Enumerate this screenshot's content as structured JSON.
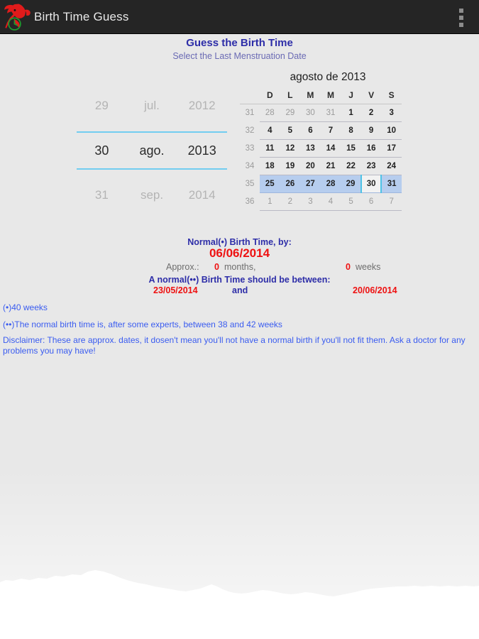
{
  "appbar": {
    "title": "Birth Time Guess",
    "logo_icon": "stork-clock-icon",
    "overflow_icon": "overflow-menu-icon"
  },
  "headings": {
    "title": "Guess the Birth Time",
    "subtitle": "Select the Last Menstruation Date"
  },
  "date_picker": {
    "day": {
      "prev": "29",
      "current": "30",
      "next": "31"
    },
    "month": {
      "prev": "jul.",
      "current": "ago.",
      "next": "sep."
    },
    "year": {
      "prev": "2012",
      "current": "2013",
      "next": "2014"
    }
  },
  "calendar": {
    "month_label": "agosto de 2013",
    "week_col_header": "",
    "weekday_headers": [
      "D",
      "L",
      "M",
      "M",
      "J",
      "V",
      "S"
    ],
    "weeks": [
      {
        "number": "31",
        "days": [
          {
            "label": "28",
            "dim": true,
            "selected_week": false,
            "today": false
          },
          {
            "label": "29",
            "dim": true,
            "selected_week": false,
            "today": false
          },
          {
            "label": "30",
            "dim": true,
            "selected_week": false,
            "today": false
          },
          {
            "label": "31",
            "dim": true,
            "selected_week": false,
            "today": false
          },
          {
            "label": "1",
            "dim": false,
            "selected_week": false,
            "today": false
          },
          {
            "label": "2",
            "dim": false,
            "selected_week": false,
            "today": false
          },
          {
            "label": "3",
            "dim": false,
            "selected_week": false,
            "today": false
          }
        ]
      },
      {
        "number": "32",
        "days": [
          {
            "label": "4",
            "dim": false,
            "selected_week": false,
            "today": false
          },
          {
            "label": "5",
            "dim": false,
            "selected_week": false,
            "today": false
          },
          {
            "label": "6",
            "dim": false,
            "selected_week": false,
            "today": false
          },
          {
            "label": "7",
            "dim": false,
            "selected_week": false,
            "today": false
          },
          {
            "label": "8",
            "dim": false,
            "selected_week": false,
            "today": false
          },
          {
            "label": "9",
            "dim": false,
            "selected_week": false,
            "today": false
          },
          {
            "label": "10",
            "dim": false,
            "selected_week": false,
            "today": false
          }
        ]
      },
      {
        "number": "33",
        "days": [
          {
            "label": "11",
            "dim": false,
            "selected_week": false,
            "today": false
          },
          {
            "label": "12",
            "dim": false,
            "selected_week": false,
            "today": false
          },
          {
            "label": "13",
            "dim": false,
            "selected_week": false,
            "today": false
          },
          {
            "label": "14",
            "dim": false,
            "selected_week": false,
            "today": false
          },
          {
            "label": "15",
            "dim": false,
            "selected_week": false,
            "today": false
          },
          {
            "label": "16",
            "dim": false,
            "selected_week": false,
            "today": false
          },
          {
            "label": "17",
            "dim": false,
            "selected_week": false,
            "today": false
          }
        ]
      },
      {
        "number": "34",
        "days": [
          {
            "label": "18",
            "dim": false,
            "selected_week": false,
            "today": false
          },
          {
            "label": "19",
            "dim": false,
            "selected_week": false,
            "today": false
          },
          {
            "label": "20",
            "dim": false,
            "selected_week": false,
            "today": false
          },
          {
            "label": "21",
            "dim": false,
            "selected_week": false,
            "today": false
          },
          {
            "label": "22",
            "dim": false,
            "selected_week": false,
            "today": false
          },
          {
            "label": "23",
            "dim": false,
            "selected_week": false,
            "today": false
          },
          {
            "label": "24",
            "dim": false,
            "selected_week": false,
            "today": false
          }
        ]
      },
      {
        "number": "35",
        "days": [
          {
            "label": "25",
            "dim": false,
            "selected_week": true,
            "today": false
          },
          {
            "label": "26",
            "dim": false,
            "selected_week": true,
            "today": false
          },
          {
            "label": "27",
            "dim": false,
            "selected_week": true,
            "today": false
          },
          {
            "label": "28",
            "dim": false,
            "selected_week": true,
            "today": false
          },
          {
            "label": "29",
            "dim": false,
            "selected_week": true,
            "today": false
          },
          {
            "label": "30",
            "dim": false,
            "selected_week": true,
            "today": true
          },
          {
            "label": "31",
            "dim": false,
            "selected_week": true,
            "today": false
          }
        ]
      },
      {
        "number": "36",
        "days": [
          {
            "label": "1",
            "dim": true,
            "selected_week": false,
            "today": false
          },
          {
            "label": "2",
            "dim": true,
            "selected_week": false,
            "today": false
          },
          {
            "label": "3",
            "dim": true,
            "selected_week": false,
            "today": false
          },
          {
            "label": "4",
            "dim": true,
            "selected_week": false,
            "today": false
          },
          {
            "label": "5",
            "dim": true,
            "selected_week": false,
            "today": false
          },
          {
            "label": "6",
            "dim": true,
            "selected_week": false,
            "today": false
          },
          {
            "label": "7",
            "dim": true,
            "selected_week": false,
            "today": false
          }
        ]
      }
    ]
  },
  "results": {
    "normal_label": "Normal(•) Birth Time, by:",
    "normal_date": "06/06/2014",
    "approx_label": "Approx.:",
    "approx_months_value": "0",
    "approx_months_unit": "months,",
    "approx_weeks_value": "0",
    "approx_weeks_unit": "weeks",
    "between_label": "A normal(••) Birth Time should be between:",
    "range_from": "23/05/2014",
    "range_and": "and",
    "range_to": "20/06/2014"
  },
  "notes": {
    "note1": "(•)40 weeks",
    "note2": "(••)The normal birth time is, after some experts, between 38 and 42 weeks",
    "disclaimer": "Disclaimer: These are approx. dates, it dosen't mean you'll not have a normal birth if you'll not fit them. Ask a doctor for any problems you may have!"
  },
  "colors": {
    "appbar_bg": "#252525",
    "page_bg": "#e8e8e8",
    "heading_blue": "#2d2da8",
    "subheading_blue": "#6a6ab4",
    "value_red": "#ee1111",
    "note_blue": "#3a5cf0",
    "accent_cyan": "#4ec3e6",
    "selected_week_bg": "#b6cdee",
    "logo_red": "#e01b1b",
    "logo_green": "#1f9b2e"
  }
}
